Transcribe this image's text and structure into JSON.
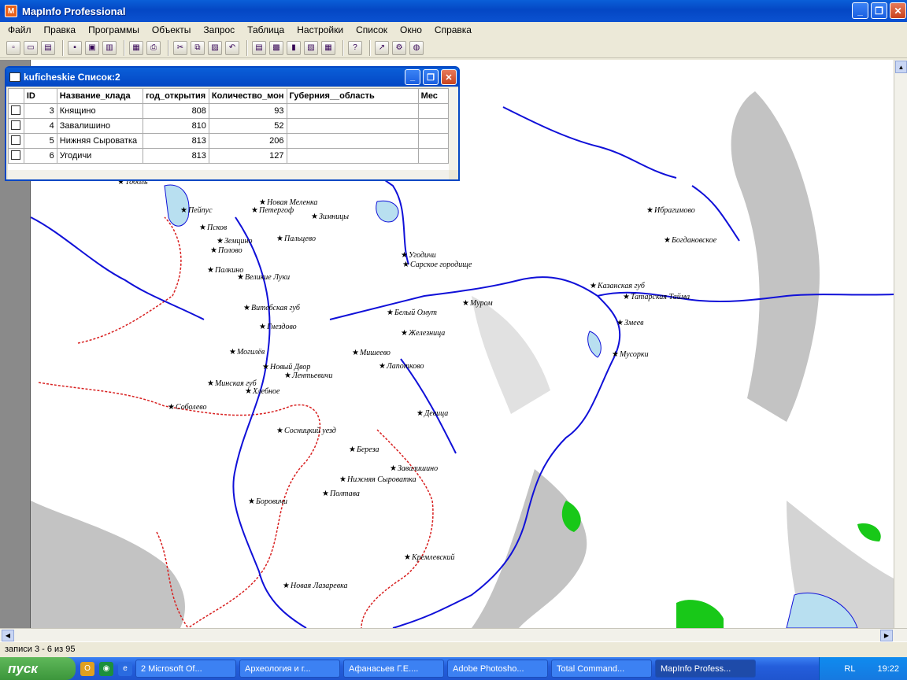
{
  "app": {
    "title": "MapInfo Professional",
    "logo_char": "M"
  },
  "window_buttons": {
    "minimize": "_",
    "restore": "❐",
    "close": "✕"
  },
  "menu": [
    "Файл",
    "Правка",
    "Программы",
    "Объекты",
    "Запрос",
    "Таблица",
    "Настройки",
    "Список",
    "Окно",
    "Справка"
  ],
  "toolbar_icons": [
    "new-icon",
    "open-icon",
    "open-workspace-icon",
    "save-icon",
    "save-copy-icon",
    "close-table-icon",
    "new-map-icon",
    "print-icon",
    "cut-icon",
    "copy-icon",
    "paste-icon",
    "undo-icon",
    "browse-icon",
    "map-icon",
    "graph-icon",
    "layout-icon",
    "redistrict-icon",
    "help-icon",
    "hotlink-icon",
    "tool-icon",
    "globe-icon"
  ],
  "table_window": {
    "title": "kuficheskie Список:2",
    "columns": [
      "ID",
      "Название_клада",
      "год_открытия",
      "Количество_мон",
      "Губерния__область",
      "Мес"
    ],
    "rows": [
      {
        "id": "3",
        "name": "Княщино",
        "year": "808",
        "count": "93",
        "region": ""
      },
      {
        "id": "4",
        "name": "Завалишино",
        "year": "810",
        "count": "52",
        "region": ""
      },
      {
        "id": "5",
        "name": "Нижняя Сыроватка",
        "year": "813",
        "count": "206",
        "region": ""
      },
      {
        "id": "6",
        "name": "Угодичи",
        "year": "813",
        "count": "127",
        "region": ""
      }
    ]
  },
  "map": {
    "colors": {
      "water": "#1010d8",
      "relief": "#b4b4b4",
      "border": "#d82020",
      "green": "#18c818"
    },
    "places": [
      "Новая Меленка",
      "Петергоф",
      "Тоболь",
      "Пейпус",
      "Псков",
      "Земцино",
      "Полово",
      "Палкино",
      "Великие Луки",
      "Витебская губ",
      "Могилёв",
      "Новый Двор",
      "Минская губ",
      "Соболево",
      "Сосницкий уезд",
      "Полтава",
      "Боровичи",
      "Новая Лазаревка",
      "Кремлевский",
      "Береза",
      "Нижняя Сыроватка",
      "Завалишино",
      "Девица",
      "Лапотково",
      "Мишеево",
      "Железница",
      "Белый Омут",
      "Муром",
      "Угодичи",
      "Сарское городище",
      "Казанская губ",
      "Татарская Тайма",
      "Змеев",
      "Мусорки",
      "Богдановское",
      "Ибрагимово",
      "Зимницы",
      "Пальцево",
      "Гнездово",
      "Хлебное",
      "Лентьевичи"
    ]
  },
  "status": {
    "text": "записи 3 - 6 из 95"
  },
  "taskbar": {
    "start": "пуск",
    "tasks": [
      "2 Microsoft Of...",
      "Археология и г...",
      "Афанасьев Г.Е....",
      "Adobe Photosho...",
      "Total Command...",
      "MapInfo Profess..."
    ],
    "lang": "RL",
    "clock": "19:22"
  }
}
